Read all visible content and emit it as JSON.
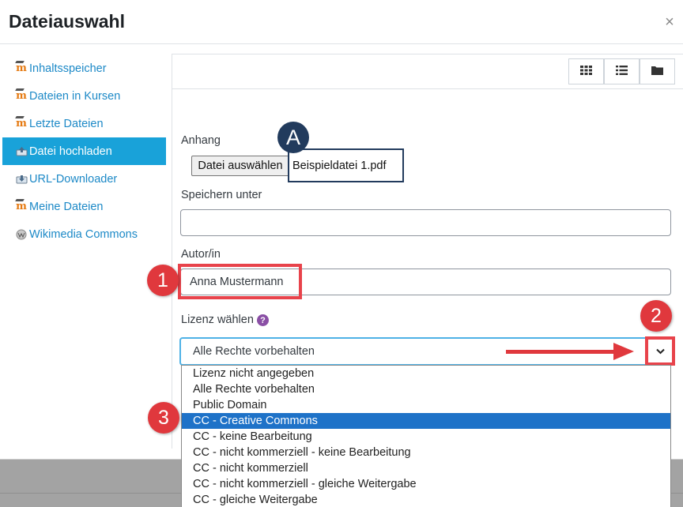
{
  "dialog": {
    "title": "Dateiauswahl",
    "close_label": "×"
  },
  "sidebar": {
    "items": [
      {
        "label": "Inhaltsspeicher",
        "icon": "moodle-icon"
      },
      {
        "label": "Dateien in Kursen",
        "icon": "moodle-icon"
      },
      {
        "label": "Letzte Dateien",
        "icon": "moodle-icon"
      },
      {
        "label": "Datei hochladen",
        "icon": "upload-icon",
        "active": true
      },
      {
        "label": "URL-Downloader",
        "icon": "url-download-icon"
      },
      {
        "label": "Meine Dateien",
        "icon": "moodle-icon"
      },
      {
        "label": "Wikimedia Commons",
        "icon": "wikimedia-icon"
      }
    ]
  },
  "toolbar": {
    "views": [
      "grid-view-icon",
      "list-view-icon",
      "folder-view-icon"
    ]
  },
  "form": {
    "attachment_label": "Anhang",
    "choose_file_button": "Datei auswählen",
    "file_name": "Beispieldatei 1.pdf",
    "save_as_label": "Speichern unter",
    "save_as_value": "",
    "author_label": "Autor/in",
    "author_value": "Anna Mustermann",
    "license_label": "Lizenz wählen",
    "license_selected": "Alle Rechte vorbehalten",
    "license_options": [
      "Lizenz nicht angegeben",
      "Alle Rechte vorbehalten",
      "Public Domain",
      "CC - Creative Commons",
      "CC - keine Bearbeitung",
      "CC - nicht kommerziell - keine Bearbeitung",
      "CC - nicht kommerziell",
      "CC - nicht kommerziell - gleiche Weitergabe",
      "CC - gleiche Weitergabe"
    ],
    "highlighted_option": "CC - Creative Commons"
  },
  "annotations": {
    "badge_a": "A",
    "badge_1": "1",
    "badge_2": "2",
    "badge_3": "3"
  },
  "colors": {
    "accent": "#19a2d9",
    "link": "#1c89c7",
    "annotation_red": "#e0383d",
    "annotation_navy": "#223b5d",
    "selected_option": "#1e72c8"
  }
}
